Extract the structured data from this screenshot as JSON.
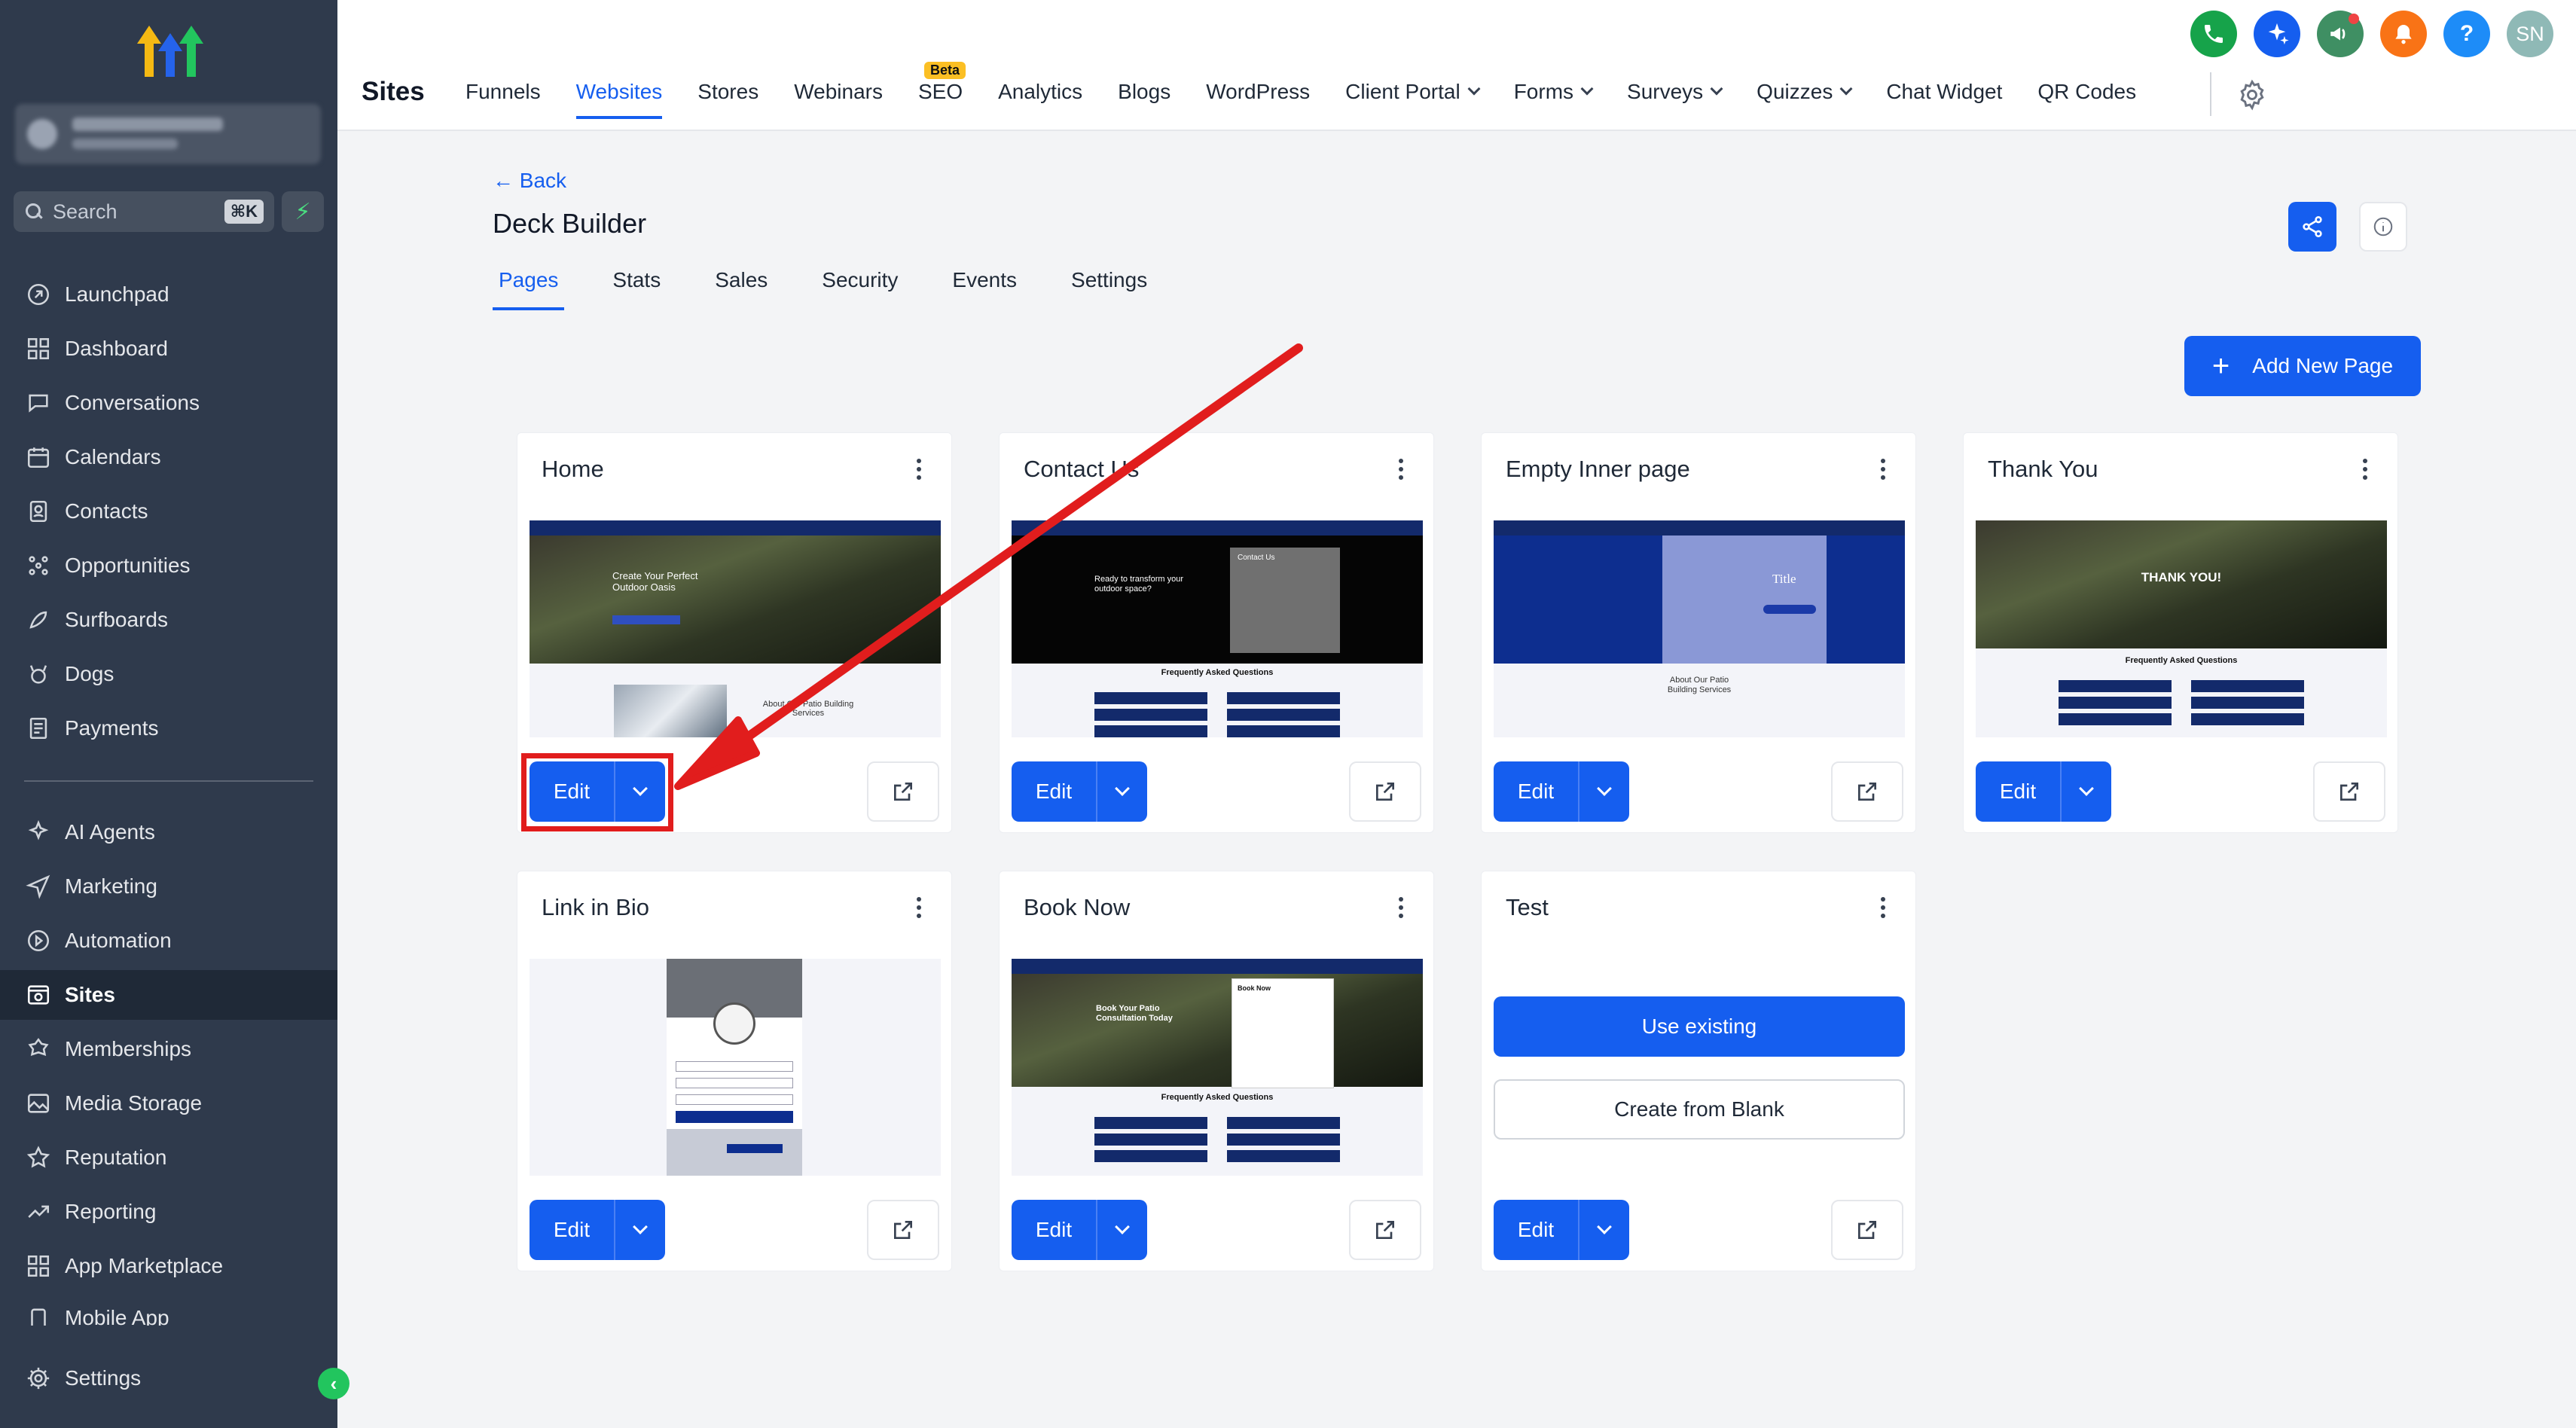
{
  "sidebar": {
    "search_label": "Search",
    "search_shortcut": "⌘K",
    "items": [
      {
        "label": "Launchpad",
        "icon": "launchpad-icon"
      },
      {
        "label": "Dashboard",
        "icon": "dashboard-icon"
      },
      {
        "label": "Conversations",
        "icon": "chat-icon"
      },
      {
        "label": "Calendars",
        "icon": "calendar-icon"
      },
      {
        "label": "Contacts",
        "icon": "contacts-icon"
      },
      {
        "label": "Opportunities",
        "icon": "opportunities-icon"
      },
      {
        "label": "Surfboards",
        "icon": "surfboard-icon"
      },
      {
        "label": "Dogs",
        "icon": "dog-icon"
      },
      {
        "label": "Payments",
        "icon": "payments-icon"
      }
    ],
    "items2": [
      {
        "label": "AI Agents",
        "icon": "ai-agents-icon"
      },
      {
        "label": "Marketing",
        "icon": "marketing-icon"
      },
      {
        "label": "Automation",
        "icon": "automation-icon"
      },
      {
        "label": "Sites",
        "icon": "sites-icon",
        "active": true
      },
      {
        "label": "Memberships",
        "icon": "memberships-icon"
      },
      {
        "label": "Media Storage",
        "icon": "media-icon"
      },
      {
        "label": "Reputation",
        "icon": "star-icon"
      },
      {
        "label": "Reporting",
        "icon": "reporting-icon"
      },
      {
        "label": "App Marketplace",
        "icon": "marketplace-icon"
      },
      {
        "label": "Mobile App",
        "icon": "mobile-icon"
      }
    ],
    "settings_label": "Settings"
  },
  "header": {
    "title": "Sites",
    "nav": [
      {
        "label": "Funnels"
      },
      {
        "label": "Websites",
        "active": true
      },
      {
        "label": "Stores"
      },
      {
        "label": "Webinars"
      },
      {
        "label": "SEO",
        "badge": "Beta"
      },
      {
        "label": "Analytics"
      },
      {
        "label": "Blogs"
      },
      {
        "label": "WordPress"
      },
      {
        "label": "Client Portal",
        "dropdown": true
      },
      {
        "label": "Forms",
        "dropdown": true
      },
      {
        "label": "Surveys",
        "dropdown": true
      },
      {
        "label": "Quizzes",
        "dropdown": true
      },
      {
        "label": "Chat Widget"
      },
      {
        "label": "QR Codes"
      }
    ],
    "avatar_initials": "SN",
    "colors": {
      "phone": "#16a34a",
      "ai": "#155eef",
      "announce": "#3f8f63",
      "bell": "#f97316",
      "help": "#1d8cf8",
      "avatar": "#8fb9b6"
    }
  },
  "main": {
    "back_label": "Back",
    "page_title": "Deck Builder",
    "tabs": [
      "Pages",
      "Stats",
      "Sales",
      "Security",
      "Events",
      "Settings"
    ],
    "active_tab": "Pages",
    "add_page_label": "Add New Page",
    "edit_label": "Edit",
    "use_existing_label": "Use existing",
    "create_blank_label": "Create from Blank",
    "pages": [
      {
        "title": "Home",
        "thumb": "home"
      },
      {
        "title": "Contact Us",
        "thumb": "contact"
      },
      {
        "title": "Empty Inner page",
        "thumb": "empty"
      },
      {
        "title": "Thank You",
        "thumb": "thanks"
      },
      {
        "title": "Link in Bio",
        "thumb": "bio"
      },
      {
        "title": "Book Now",
        "thumb": "book"
      },
      {
        "title": "Test",
        "thumb": "none"
      }
    ],
    "thumb_text": {
      "home_headline": "Create Your Perfect Outdoor Oasis",
      "home_about": "About Our Patio Building Services",
      "contact_headline": "Ready to transform your outdoor space?",
      "contact_form": "Contact Us",
      "faq": "Frequently Asked Questions",
      "empty_title": "Title",
      "empty_about": "About Our Patio Building Services",
      "thanks_headline": "THANK YOU!",
      "book_headline": "Book Your Patio Consultation Today",
      "book_form": "Book Now"
    }
  },
  "accent": "#155eef",
  "annotation_color": "#e11d1d"
}
